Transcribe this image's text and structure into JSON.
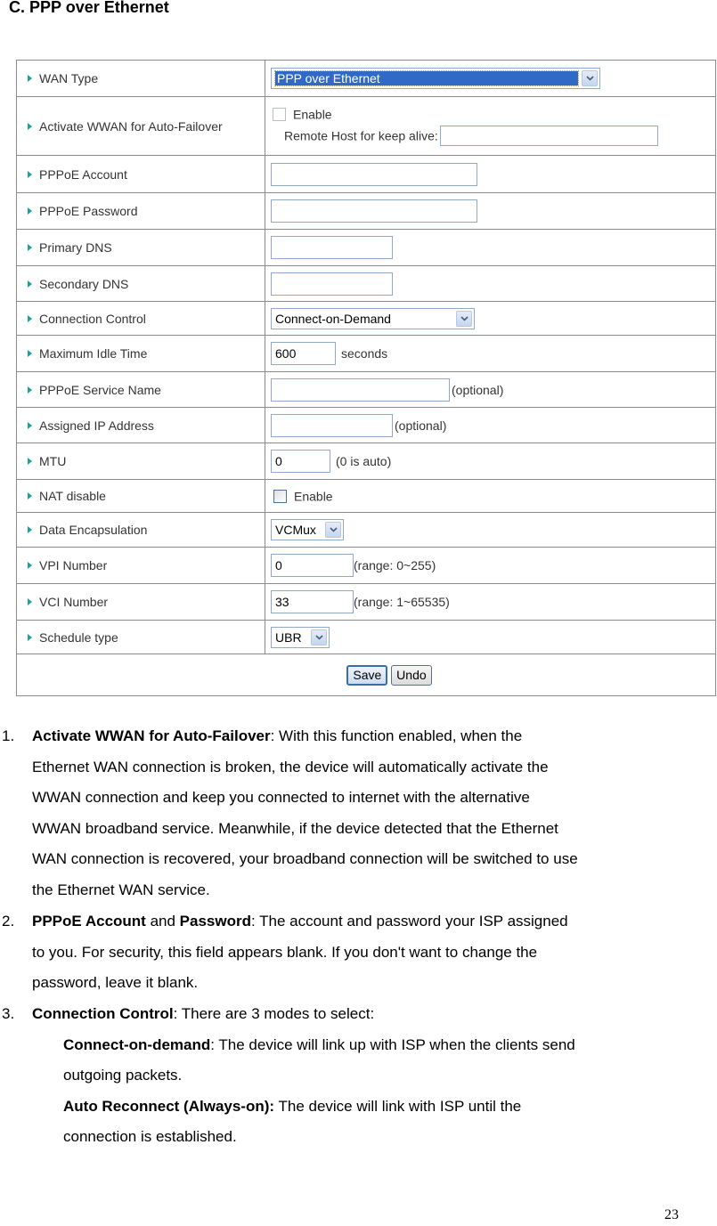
{
  "section_title": "C. PPP over Ethernet",
  "form": {
    "rows": [
      {
        "label": "WAN Type",
        "select_value": "PPP over Ethernet"
      },
      {
        "label": "Activate WWAN for Auto-Failover",
        "checkbox_label": "Enable",
        "checked": false,
        "sub_label": "Remote Host for keep alive:",
        "input_value": ""
      },
      {
        "label": "PPPoE Account",
        "input_value": ""
      },
      {
        "label": "PPPoE Password",
        "input_value": ""
      },
      {
        "label": "Primary DNS",
        "input_value": ""
      },
      {
        "label": "Secondary DNS",
        "input_value": ""
      },
      {
        "label": "Connection Control",
        "select_value": "Connect-on-Demand"
      },
      {
        "label": "Maximum Idle Time",
        "input_value": "600",
        "suffix": "seconds"
      },
      {
        "label": "PPPoE Service Name",
        "input_value": "",
        "suffix": "(optional)"
      },
      {
        "label": "Assigned IP Address",
        "input_value": "",
        "suffix": "(optional)"
      },
      {
        "label": "MTU",
        "input_value": "0",
        "suffix": "(0 is auto)"
      },
      {
        "label": "NAT disable",
        "checkbox_label": "Enable",
        "checked": false
      },
      {
        "label": "Data Encapsulation",
        "select_value": "VCMux"
      },
      {
        "label": "VPI Number",
        "input_value": "0",
        "suffix": "(range: 0~255)"
      },
      {
        "label": "VCI Number",
        "input_value": "33",
        "suffix": "(range: 1~65535)"
      },
      {
        "label": "Schedule type",
        "select_value": "UBR"
      }
    ],
    "save_label": "Save",
    "undo_label": "Undo"
  },
  "notes": {
    "item1": {
      "number": "1.",
      "bold": "Activate WWAN for Auto-Failover",
      "lines": [
        ": With this function enabled, when the",
        "Ethernet WAN connection is broken, the device will automatically activate the",
        "WWAN connection and keep you connected to internet with the alternative",
        "WWAN broadband service. Meanwhile, if the device detected that the Ethernet",
        "WAN connection is recovered, your broadband connection will be switched to use",
        "the Ethernet WAN service."
      ]
    },
    "item2": {
      "number": "2.",
      "bold1": "PPPoE Account",
      "mid": " and ",
      "bold2": "Password",
      "lines": [
        ": The account and password your ISP assigned",
        "to you. For security, this field appears blank. If you don't want to change the",
        "password, leave it blank."
      ]
    },
    "item3": {
      "number": "3.",
      "bold": "Connection Control",
      "text": ": There are 3 modes to select:",
      "modes": [
        {
          "bold": "Connect-on-demand",
          "lines": [
            ": The device will link up with ISP when the clients send",
            "outgoing packets."
          ]
        },
        {
          "bold": "Auto Reconnect (Always-on):",
          "lines": [
            " The device will link with ISP until the",
            "connection is established."
          ]
        }
      ]
    }
  },
  "page_number": "23"
}
